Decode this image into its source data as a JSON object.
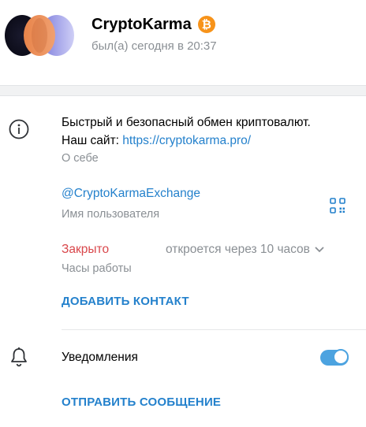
{
  "profile": {
    "name": "CryptoKarma",
    "badge_symbol": "₿",
    "last_seen": "был(а) сегодня в 20:37"
  },
  "about": {
    "line1": "Быстрый и безопасный обмен криптовалют.",
    "site_prefix": "Наш сайт: ",
    "site_link": "https://cryptokarma.pro/",
    "caption": "О себе"
  },
  "username": {
    "value": "@CryptoKarmaExchange",
    "caption": "Имя пользователя"
  },
  "hours": {
    "status": "Закрыто",
    "opens": "откроется через 10 часов",
    "caption": "Часы работы"
  },
  "actions": {
    "add_contact": "ДОБАВИТЬ КОНТАКТ",
    "send_message": "ОТПРАВИТЬ СООБЩЕНИЕ"
  },
  "notifications": {
    "label": "Уведомления",
    "enabled": true
  },
  "colors": {
    "accent": "#2481cc",
    "closed": "#d9474b",
    "toggle": "#4ca3e0",
    "bitcoin": "#f7931a"
  },
  "icons": [
    "info-icon",
    "qr-code-icon",
    "chevron-down-icon",
    "bell-icon",
    "bitcoin-icon"
  ]
}
